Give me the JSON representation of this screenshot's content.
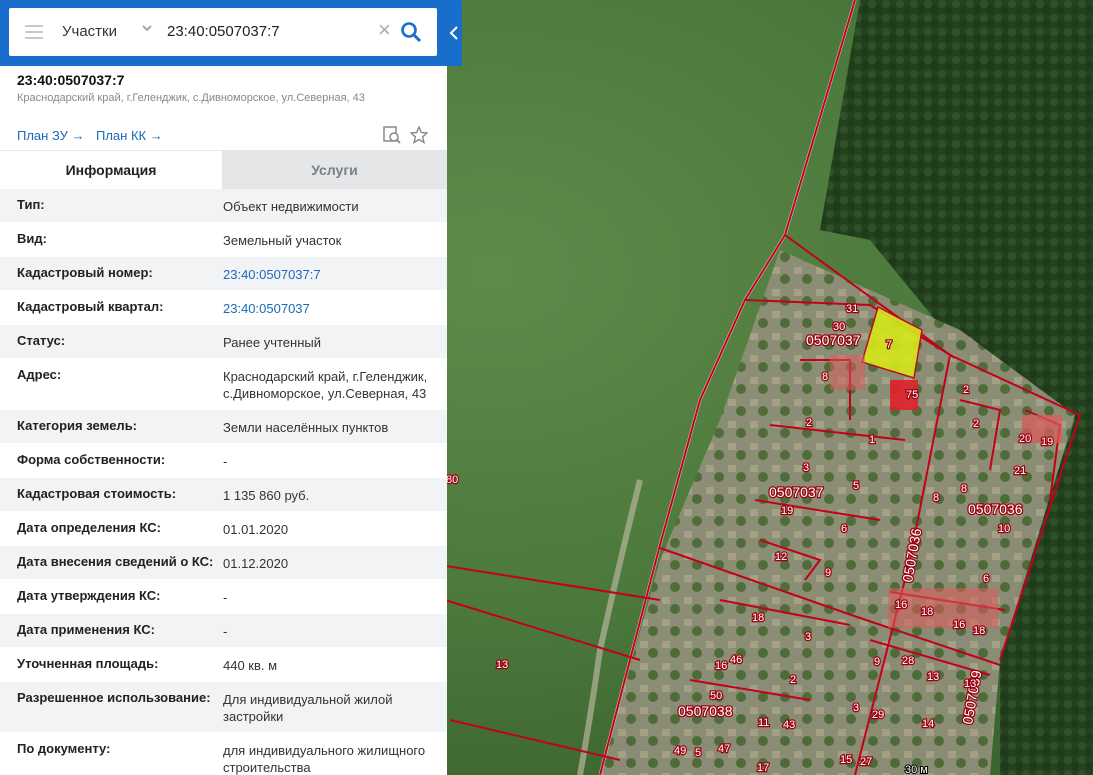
{
  "search": {
    "category": "Участки",
    "query": "23:40:0507037:7"
  },
  "object": {
    "title": "23:40:0507037:7",
    "address": "Краснодарский край, г.Геленджик, с.Дивноморское, ул.Северная, 43"
  },
  "links": {
    "plan_zu": "План ЗУ →",
    "plan_kk": "План КК →"
  },
  "tabs": [
    {
      "label": "Информация"
    },
    {
      "label": "Услуги"
    }
  ],
  "info_rows": [
    {
      "key": "Тип:",
      "value": "Объект недвижимости"
    },
    {
      "key": "Вид:",
      "value": "Земельный участок"
    },
    {
      "key": "Кадастровый номер:",
      "value": "23:40:0507037:7"
    },
    {
      "key": "Кадастровый квартал:",
      "value": "23:40:0507037"
    },
    {
      "key": "Статус:",
      "value": "Ранее учтенный"
    },
    {
      "key": "Адрес:",
      "value": "Краснодарский край, г.Геленджик, с.Дивноморское, ул.Северная, 43"
    },
    {
      "key": "Категория земель:",
      "value": "Земли населённых пунктов"
    },
    {
      "key": "Форма собственности:",
      "value": "-"
    },
    {
      "key": "Кадастровая стоимость:",
      "value": "1 135 860 руб."
    },
    {
      "key": "Дата определения КС:",
      "value": "01.01.2020"
    },
    {
      "key": "Дата внесения сведений о КС:",
      "value": "01.12.2020"
    },
    {
      "key": "Дата утверждения КС:",
      "value": "-"
    },
    {
      "key": "Дата применения КС:",
      "value": "-"
    },
    {
      "key": "Уточненная площадь:",
      "value": "440 кв. м"
    },
    {
      "key": "Разрешенное использование:",
      "value": "Для индивидуальной жилой застройки"
    },
    {
      "key": "По документу:",
      "value": "для индивидуального жилищного строительства"
    }
  ],
  "map": {
    "quarter_labels": [
      "0507037",
      "0507037",
      "0507036",
      "0507036",
      "0507038",
      "0507039"
    ],
    "parcel_labels": [
      "31",
      "30",
      "7",
      "8",
      "75",
      "2",
      "1",
      "3",
      "5",
      "19",
      "6",
      "12",
      "9",
      "2",
      "2",
      "20",
      "19",
      "21",
      "8",
      "8",
      "10",
      "6",
      "16",
      "18",
      "16",
      "18",
      "18",
      "3",
      "46",
      "16",
      "2",
      "50",
      "11",
      "43",
      "49",
      "5",
      "47",
      "17",
      "9",
      "28",
      "13",
      "13",
      "3",
      "29",
      "14",
      "15",
      "27",
      "13",
      "80"
    ],
    "scale": "30 м"
  },
  "colors": {
    "header_blue": "#1a6ecb",
    "link_blue": "#1b6ab8",
    "parcel_border": "#c4001a",
    "selected_parcel": "#d6e81a"
  }
}
